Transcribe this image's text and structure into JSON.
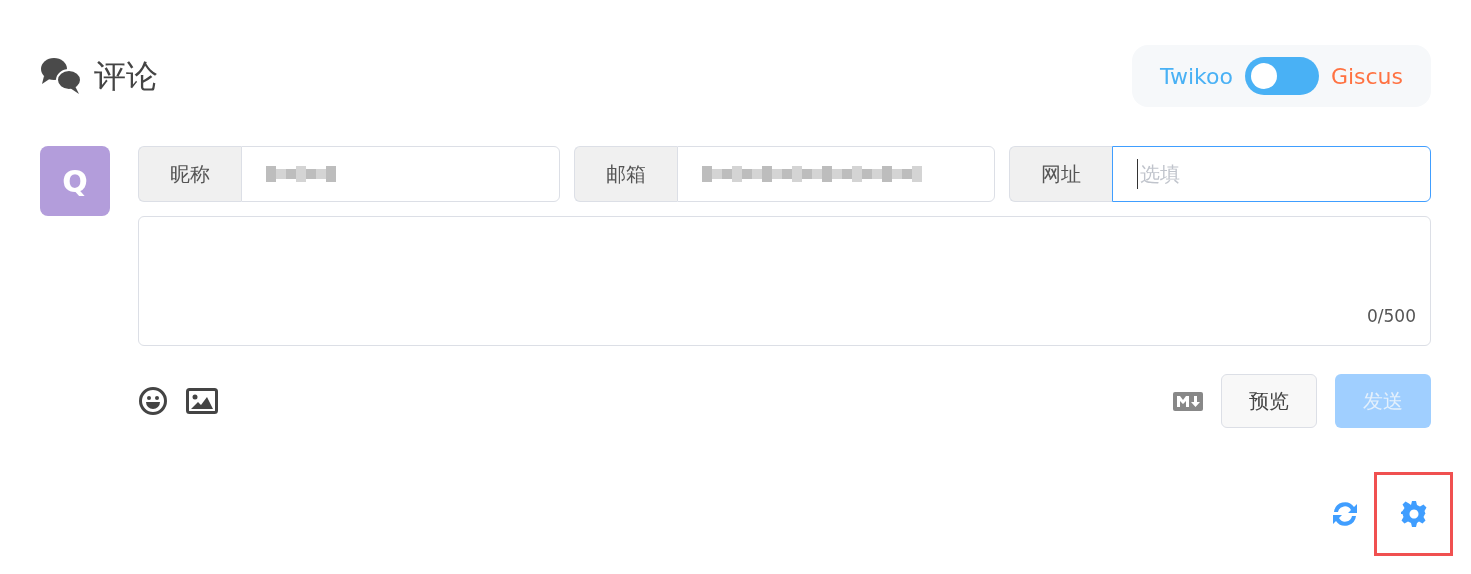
{
  "header": {
    "title": "评论",
    "switch": {
      "left_label": "Twikoo",
      "right_label": "Giscus",
      "checked": false
    }
  },
  "avatar": {
    "letter": "Q"
  },
  "fields": [
    {
      "label": "昵称",
      "value_redacted": true,
      "focused": false
    },
    {
      "label": "邮箱",
      "value_redacted": true,
      "focused": false
    },
    {
      "label": "网址",
      "placeholder": "选填",
      "focused": true
    }
  ],
  "textarea": {
    "counter": "0/500"
  },
  "actions": {
    "preview": "预览",
    "send": "发送",
    "send_disabled": true
  },
  "footer": {
    "settings_highlighted": true
  }
}
